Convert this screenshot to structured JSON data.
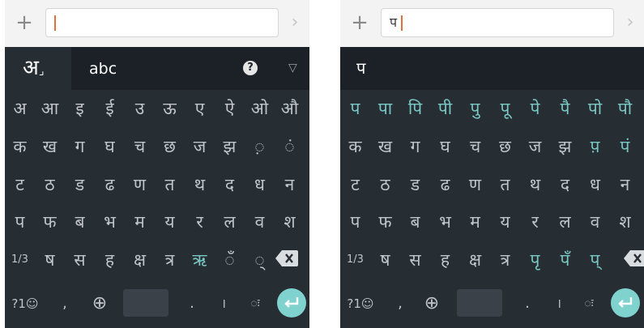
{
  "left": {
    "input_value": "",
    "candidate_bar": {
      "lang_hindi": "अ",
      "lang_mark": "⌟",
      "lang_latin": "abc",
      "help": "?",
      "collapse": "▽"
    },
    "rows": [
      [
        "अ",
        "आ",
        "इ",
        "ई",
        "उ",
        "ऊ",
        "ए",
        "ऐ",
        "ओ",
        "औ"
      ],
      [
        "क",
        "ख",
        "ग",
        "घ",
        "च",
        "छ",
        "ज",
        "झ",
        "◌़",
        "◌ं"
      ],
      [
        "ट",
        "ठ",
        "ड",
        "ढ",
        "ण",
        "त",
        "थ",
        "द",
        "ध",
        "न"
      ],
      [
        "प",
        "फ",
        "ब",
        "भ",
        "म",
        "य",
        "र",
        "ल",
        "व",
        "श"
      ],
      [
        "1/3",
        "ष",
        "स",
        "ह",
        "क्ष",
        "त्र",
        "ऋ",
        "◌ँ",
        "◌्"
      ]
    ],
    "highlight": [
      [
        false,
        false,
        false,
        false,
        false,
        false,
        false,
        false,
        false,
        false
      ],
      [
        false,
        false,
        false,
        false,
        false,
        false,
        false,
        false,
        false,
        false
      ],
      [
        false,
        false,
        false,
        false,
        false,
        false,
        false,
        false,
        false,
        false
      ],
      [
        false,
        false,
        false,
        false,
        false,
        false,
        false,
        false,
        false,
        false
      ],
      [
        false,
        false,
        false,
        false,
        false,
        false,
        true,
        false,
        false
      ]
    ]
  },
  "right": {
    "input_value": "प",
    "candidate": "प",
    "rows": [
      [
        "प",
        "पा",
        "पि",
        "पी",
        "पु",
        "पू",
        "पे",
        "पै",
        "पो",
        "पौ"
      ],
      [
        "क",
        "ख",
        "ग",
        "घ",
        "च",
        "छ",
        "ज",
        "झ",
        "प़",
        "पं"
      ],
      [
        "ट",
        "ठ",
        "ड",
        "ढ",
        "ण",
        "त",
        "थ",
        "द",
        "ध",
        "न"
      ],
      [
        "प",
        "फ",
        "ब",
        "भ",
        "म",
        "य",
        "र",
        "ल",
        "व",
        "श"
      ],
      [
        "1/3",
        "ष",
        "स",
        "ह",
        "क्ष",
        "त्र",
        "पृ",
        "पँ",
        "प्"
      ]
    ],
    "highlight": [
      [
        true,
        true,
        true,
        true,
        true,
        true,
        true,
        true,
        true,
        true
      ],
      [
        false,
        false,
        false,
        false,
        false,
        false,
        false,
        false,
        true,
        true
      ],
      [
        false,
        false,
        false,
        false,
        false,
        false,
        false,
        false,
        false,
        false
      ],
      [
        false,
        false,
        false,
        false,
        false,
        false,
        false,
        false,
        false,
        false
      ],
      [
        false,
        false,
        false,
        false,
        false,
        false,
        true,
        true,
        true
      ]
    ]
  },
  "bottom_row": {
    "symbols": "?1☺",
    "comma": ",",
    "globe": "⊕",
    "period": ".",
    "danda": "।",
    "viram": "◌ः"
  },
  "topbar": {
    "plus": "+",
    "send": "›"
  },
  "colors": {
    "keyboard_bg": "#262d33",
    "candidate_bg": "#1b2126",
    "accent": "#7ac7c4",
    "enter": "#7fd2ce"
  }
}
